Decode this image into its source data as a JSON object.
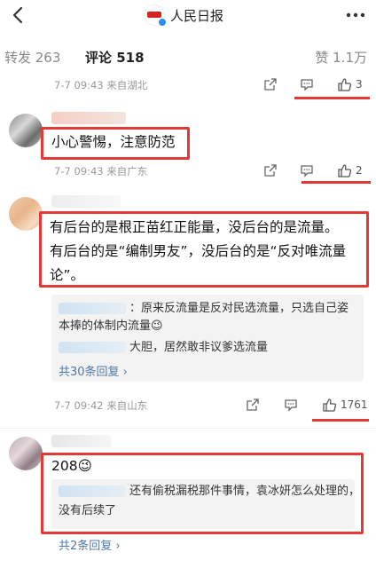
{
  "header": {
    "account_name": "人民日报"
  },
  "tabs": {
    "repost": "转发 263",
    "comments": "评论 518",
    "likes": "赞 1.1万"
  },
  "comments": [
    {
      "meta": "7-7 09:43  来自湖北",
      "like_count": "3"
    },
    {
      "text": "小心警惕，注意防范",
      "meta": "7-7 09:43  来自广东",
      "like_count": "2"
    },
    {
      "text_lines": [
        "有后台的是根正苗红正能量，没后台的是流量。",
        "有后台的是“编制男友”，没后台的是“反对唯流量",
        "论”。"
      ],
      "replies": [
        {
          "line1": "：原来反流量是反对民选流量，只选自己姿",
          "line2": "本捧的体制内流量😉"
        },
        {
          "line1": "大胆，居然敢非议爹选流量"
        }
      ],
      "more_replies": "共30条回复 ›",
      "meta": "7-7 09:42  来自山东",
      "like_count": "1761"
    },
    {
      "text": "208😉",
      "replies": [
        {
          "line1": "还有偷税漏税那件事情，袁冰妍怎么处理的，",
          "line2": "没有后续了"
        }
      ],
      "more_replies": "共2条回复 ›"
    }
  ],
  "colors": {
    "highlight": "#e53935",
    "link": "#4f78a8",
    "meta": "#999999"
  }
}
